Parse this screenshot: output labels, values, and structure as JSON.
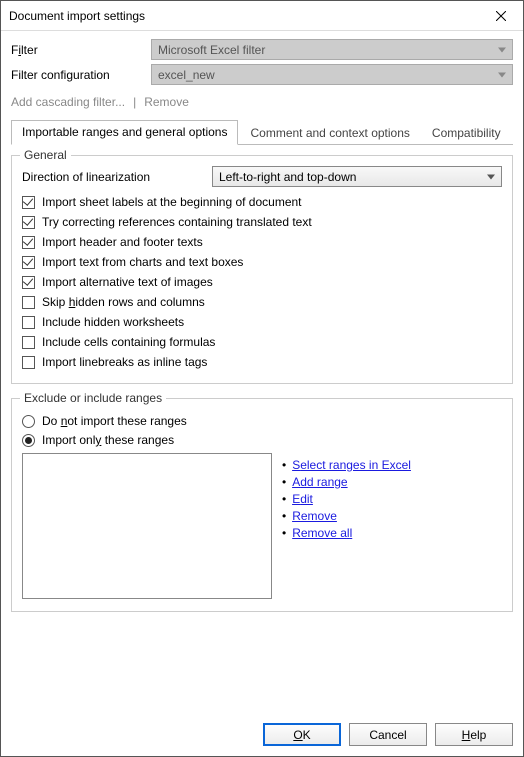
{
  "window": {
    "title": "Document import settings"
  },
  "filter": {
    "label_pre": "F",
    "label_u": "i",
    "label_post": "lter",
    "value": "Microsoft Excel filter"
  },
  "filter_config": {
    "label": "Filter configuration",
    "value": "excel_new"
  },
  "toolbar": {
    "add_cascading": "Add cascading filter...",
    "sep": "|",
    "remove": "Remove"
  },
  "tabs": {
    "t1": "Importable ranges and general options",
    "t2": "Comment and context options",
    "t3": "Compatibility"
  },
  "general": {
    "title": "General",
    "dir_label": "Direction of linearization",
    "dir_value": "Left-to-right and top-down",
    "c1": "Import sheet labels at the beginning of document",
    "c2": "Try correcting references containing translated text",
    "c3": "Import header and footer texts",
    "c4": "Import text from charts and text boxes",
    "c5": "Import alternative text of images",
    "c6_pre": "Skip ",
    "c6_u": "h",
    "c6_post": "idden rows and columns",
    "c7": "Include hidden worksheets",
    "c8": "Include cells containing formulas",
    "c9": "Import linebreaks as inline tags"
  },
  "ranges": {
    "title": "Exclude or include ranges",
    "r1_pre": "Do ",
    "r1_u": "n",
    "r1_post": "ot import these ranges",
    "r2_pre": "Import onl",
    "r2_u": "y",
    "r2_post": " these ranges",
    "a1_u": "S",
    "a1_post": "elect ranges in Excel",
    "a2_u": "A",
    "a2_post": "dd range",
    "a3_u": "E",
    "a3_post": "dit",
    "a4_u": "R",
    "a4_post": "emove",
    "a5_pre": "Remove a",
    "a5_u": "l",
    "a5_post": "l"
  },
  "buttons": {
    "ok_u": "O",
    "ok_post": "K",
    "cancel": "Cancel",
    "help_u": "H",
    "help_post": "elp"
  }
}
